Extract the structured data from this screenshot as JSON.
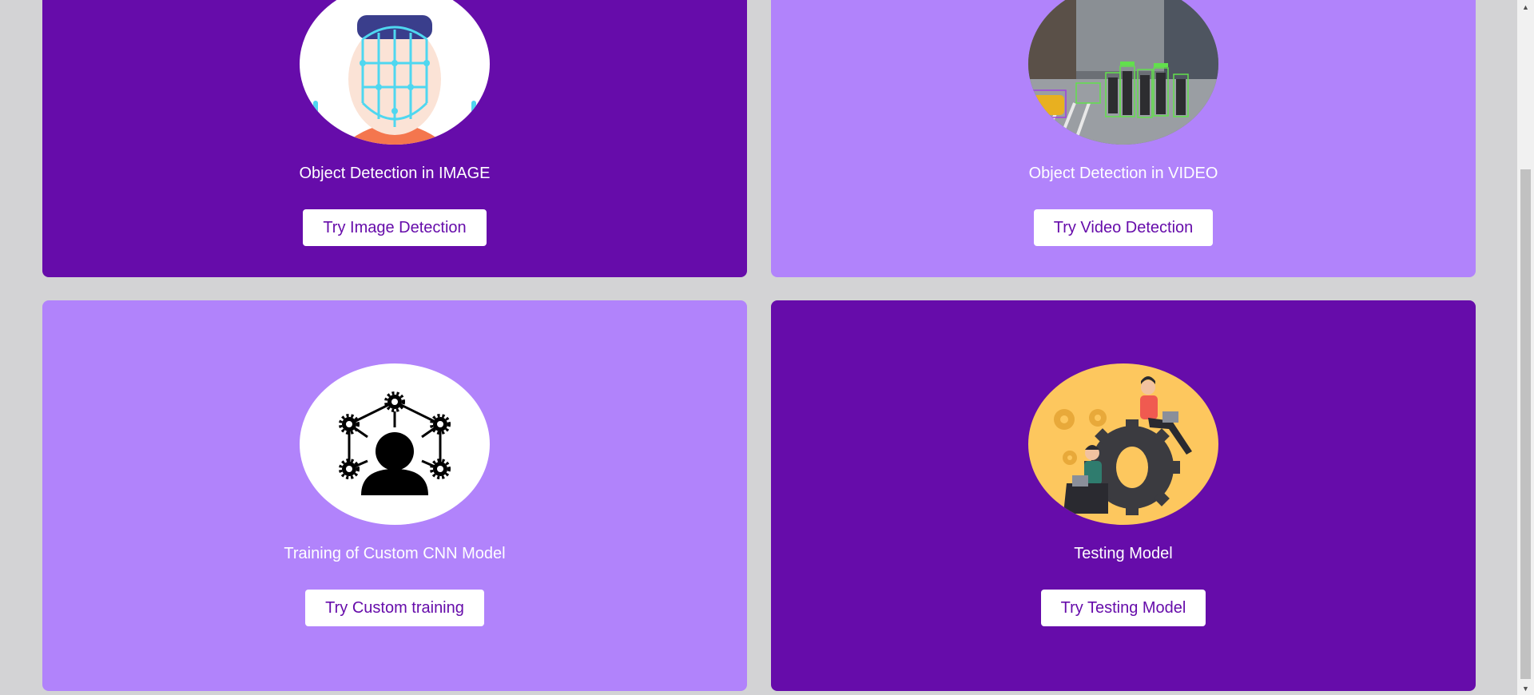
{
  "cards": [
    {
      "title": "Object Detection in IMAGE",
      "button": "Try Image Detection",
      "image": "face-recognition-illustration"
    },
    {
      "title": "Object Detection in VIDEO",
      "button": "Try Video Detection",
      "image": "street-object-detection-photo"
    },
    {
      "title": "Training of Custom CNN Model",
      "button": "Try Custom training",
      "image": "person-network-gears-icon"
    },
    {
      "title": "Testing Model",
      "button": "Try Testing Model",
      "image": "people-with-gear-illustration"
    }
  ],
  "colors": {
    "dark_card": "#660caa",
    "light_card": "#b183fb",
    "page_bg": "#d3d3d5",
    "button_text": "#660caa"
  }
}
